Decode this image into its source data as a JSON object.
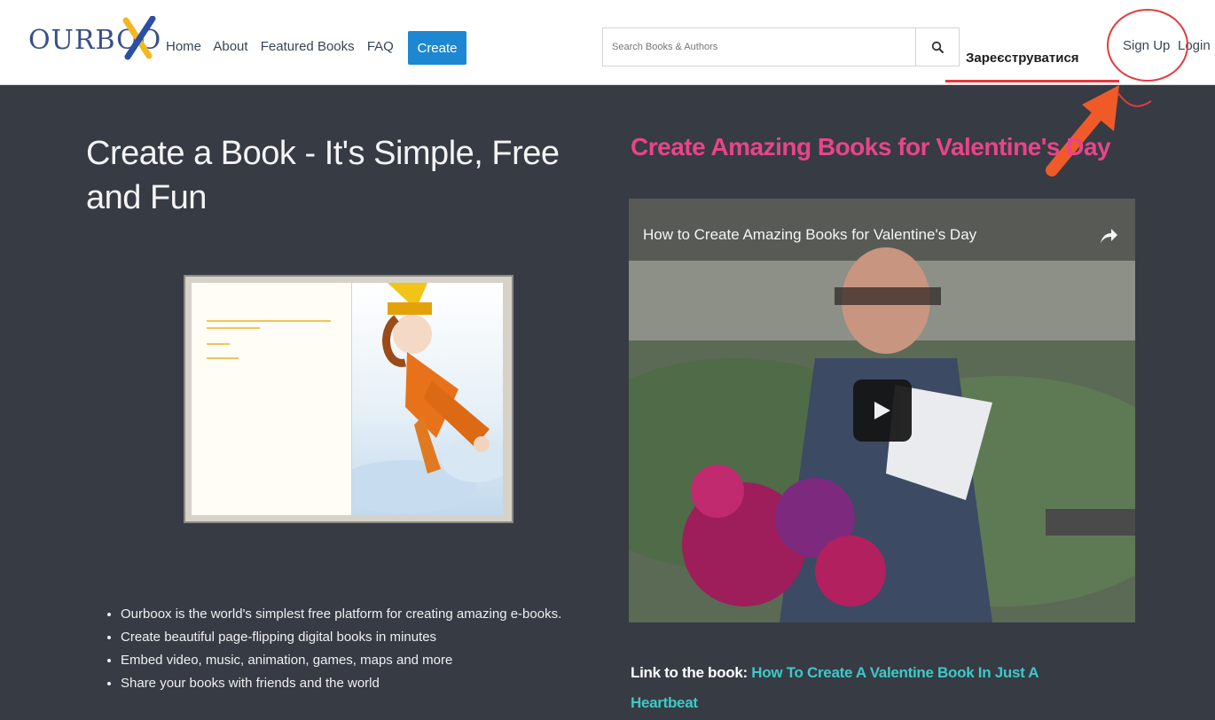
{
  "header": {
    "logo_text": "OURBOO",
    "nav": [
      {
        "label": "Home"
      },
      {
        "label": "About"
      },
      {
        "label": "Featured Books"
      },
      {
        "label": "FAQ"
      }
    ],
    "create_button": "Create",
    "search_placeholder": "Search Books & Authors",
    "annotation_text": "Зареєструватися",
    "signup": "Sign Up",
    "login": "Login"
  },
  "left": {
    "title": "Create a Book - It's Simple, Free and Fun",
    "bullets": [
      "Ourboox is the world's simplest free platform for creating amazing e-books.",
      "Create beautiful page-flipping digital books in minutes",
      "Embed video, music, animation, games, maps and more",
      "Share your books with friends and the world"
    ]
  },
  "right": {
    "title": "Create Amazing Books for Valentine's Day",
    "video_title": "How to Create Amazing Books for Valentine's Day",
    "link_label": "Link to the book:",
    "link_text": "How To Create A Valentine Book In Just A Heartbeat"
  },
  "colors": {
    "background": "#363b44",
    "accent_pink": "#e9448a",
    "link_teal": "#3ec9c6",
    "create_blue": "#1e87d1",
    "annotation_red": "#e23c3f"
  }
}
